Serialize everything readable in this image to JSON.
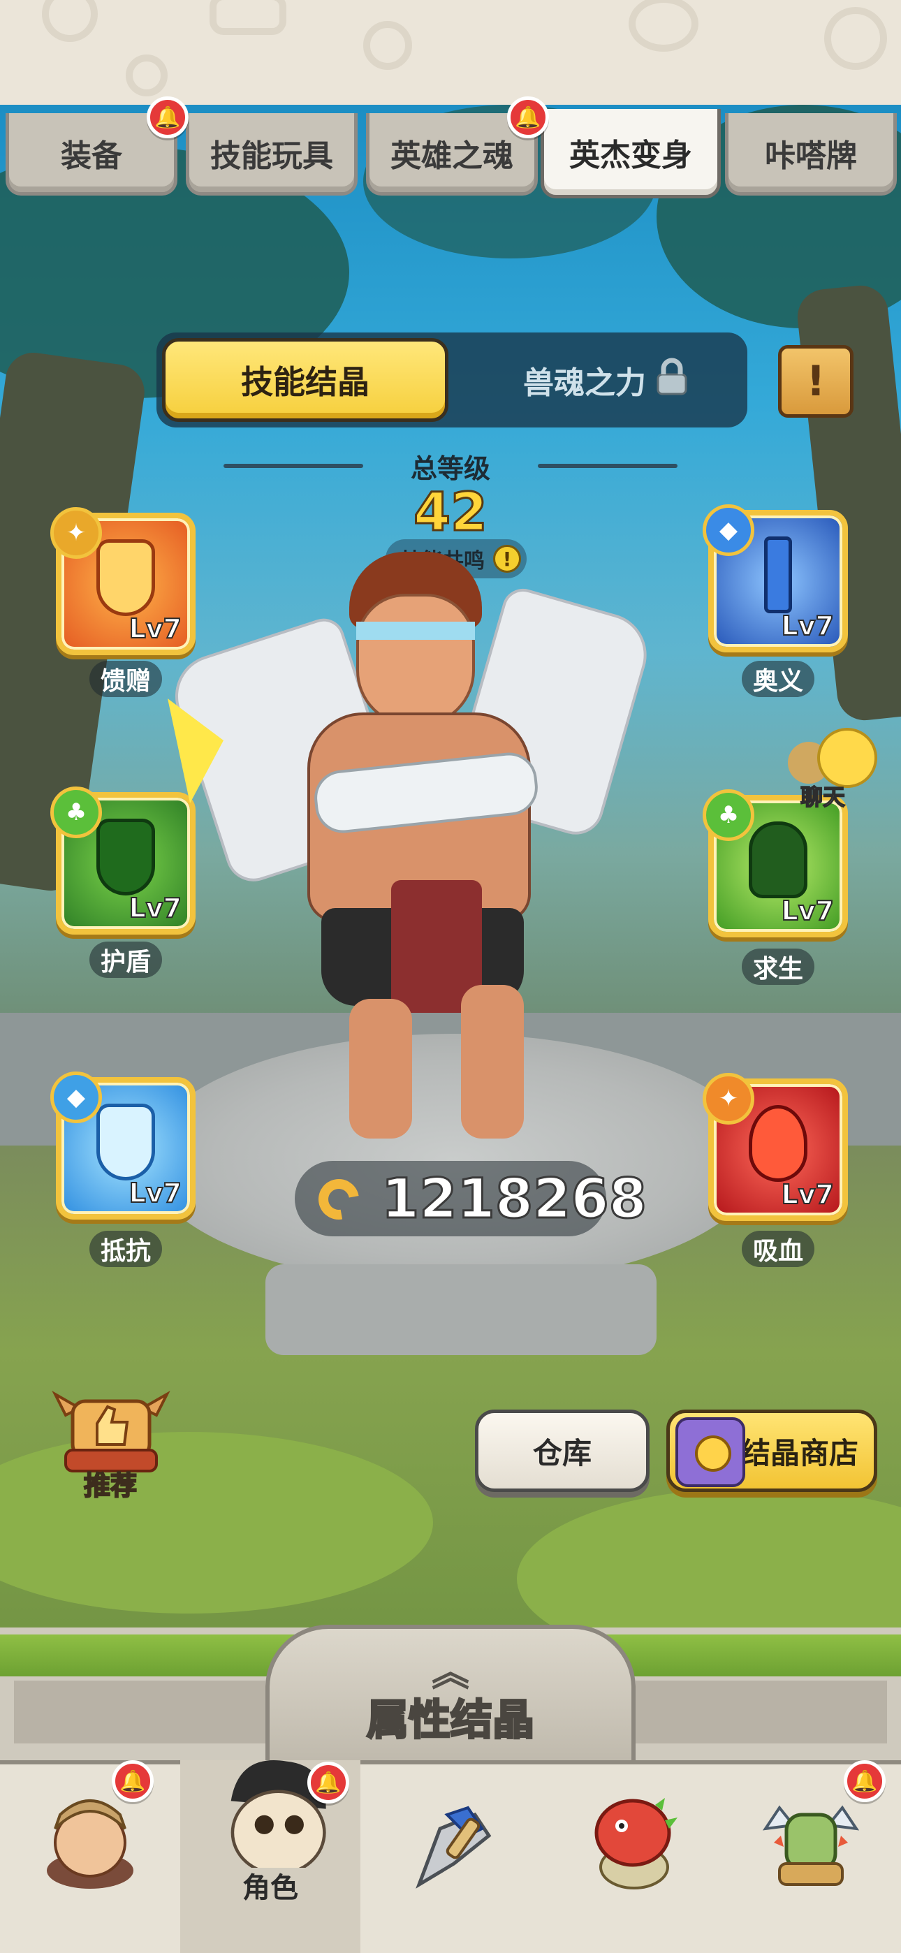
{
  "top_tabs": [
    {
      "label": "装备",
      "badge": true,
      "active": false
    },
    {
      "label": "技能玩具",
      "badge": false,
      "active": false
    },
    {
      "label": "英雄之魂",
      "badge": true,
      "active": false
    },
    {
      "label": "英杰变身",
      "badge": false,
      "active": true
    },
    {
      "label": "咔嗒牌",
      "badge": false,
      "active": false
    }
  ],
  "segment": {
    "active_label": "技能结晶",
    "locked_label": "兽魂之力",
    "locked_icon": "lock-icon"
  },
  "notice_icon": "exclamation-scroll-icon",
  "notice_symbol": "!",
  "total_level": {
    "label": "总等级",
    "value": "42",
    "resonance_label": "技能共鸣",
    "resonance_icon": "!"
  },
  "skills_left": [
    {
      "name": "馈赠",
      "level": "Lv7",
      "color": "#e8682c",
      "icon": "flame-gift-icon"
    },
    {
      "name": "护盾",
      "level": "Lv7",
      "color": "#3b9a2f",
      "icon": "shield-icon"
    },
    {
      "name": "抵抗",
      "level": "Lv7",
      "color": "#3fa6e6",
      "icon": "lightning-resist-icon"
    }
  ],
  "skills_right": [
    {
      "name": "奥义",
      "level": "Lv7",
      "color": "#3570d8",
      "icon": "sword-icon"
    },
    {
      "name": "求生",
      "level": "Lv7",
      "color": "#4fa82c",
      "icon": "hand-survive-icon"
    },
    {
      "name": "吸血",
      "level": "Lv7",
      "color": "#d5282a",
      "icon": "blood-drop-icon"
    }
  ],
  "chat": {
    "label": "聊天",
    "icon": "chat-bubbles-icon"
  },
  "currency": {
    "value": "1218268",
    "icon": "crystal-horn-icon"
  },
  "recommend": {
    "label": "推荐",
    "icon": "thumbs-up-trophy-icon"
  },
  "buttons": {
    "warehouse": "仓库",
    "crystal_shop": "结晶商店"
  },
  "drawer": {
    "title": "属性结晶",
    "chevron": "︽"
  },
  "bottom_nav": [
    {
      "label": "",
      "icon": "caveman-character-icon",
      "badge": true,
      "active": false
    },
    {
      "label": "角色",
      "icon": "hero-character-icon",
      "badge": true,
      "active": true
    },
    {
      "label": "",
      "icon": "weapon-icon",
      "badge": false,
      "active": false
    },
    {
      "label": "",
      "icon": "dino-pet-icon",
      "badge": false,
      "active": false
    },
    {
      "label": "",
      "icon": "orc-chief-icon",
      "badge": true,
      "active": false
    }
  ],
  "colors": {
    "accent_yellow": "#f6cf3c",
    "badge_red": "#e53939",
    "frame_gold": "#f2c33d"
  }
}
